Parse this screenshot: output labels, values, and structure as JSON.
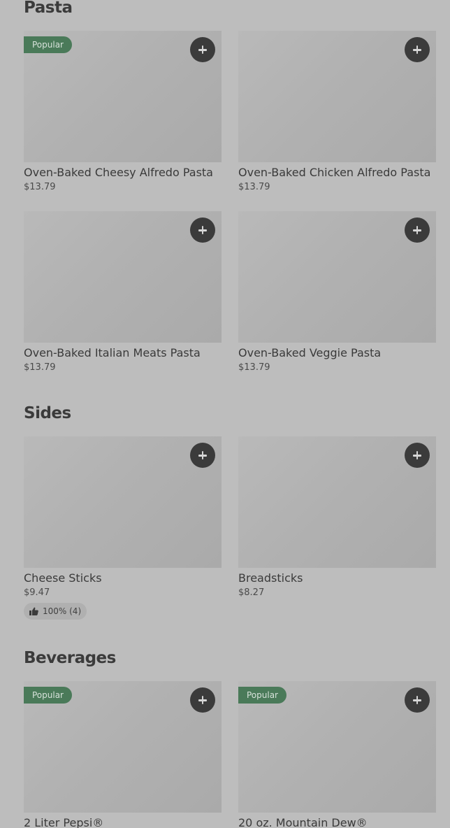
{
  "sections": {
    "pasta": {
      "title": "Pasta",
      "items": [
        {
          "name": "Oven-Baked Cheesy Alfredo Pasta",
          "price": "$13.79",
          "badge": "Popular"
        },
        {
          "name": "Oven-Baked Chicken Alfredo Pasta",
          "price": "$13.79"
        },
        {
          "name": "Oven-Baked Italian Meats Pasta",
          "price": "$13.79"
        },
        {
          "name": "Oven-Baked Veggie Pasta",
          "price": "$13.79"
        }
      ]
    },
    "sides": {
      "title": "Sides",
      "items": [
        {
          "name": "Cheese Sticks",
          "price": "$9.47",
          "rating": "100% (4)"
        },
        {
          "name": "Breadsticks",
          "price": "$8.27"
        }
      ]
    },
    "beverages": {
      "title": "Beverages",
      "items": [
        {
          "name": "2 Liter Pepsi®",
          "badge": "Popular"
        },
        {
          "name": "20 oz. Mountain Dew®",
          "badge": "Popular"
        }
      ]
    }
  },
  "icons": {
    "add": "plus-icon",
    "rating": "thumbs-up-icon"
  },
  "colors": {
    "page_background": "#bdbdbd",
    "popular_badge": "#4a7a59",
    "add_button": "#3b3b3b"
  }
}
